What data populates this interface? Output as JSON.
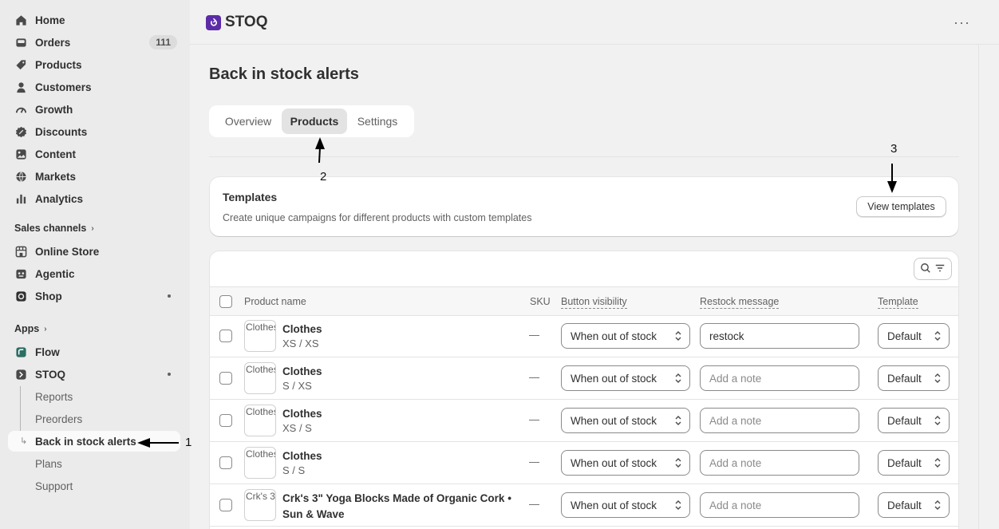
{
  "sidebar": {
    "items": [
      {
        "label": "Home",
        "icon": "home-icon"
      },
      {
        "label": "Orders",
        "icon": "inbox-icon",
        "badge": "111"
      },
      {
        "label": "Products",
        "icon": "tag-icon"
      },
      {
        "label": "Customers",
        "icon": "person-icon"
      },
      {
        "label": "Growth",
        "icon": "gauge-icon"
      },
      {
        "label": "Discounts",
        "icon": "discount-icon"
      },
      {
        "label": "Content",
        "icon": "content-icon"
      },
      {
        "label": "Markets",
        "icon": "globe-icon"
      },
      {
        "label": "Analytics",
        "icon": "bar-chart-icon"
      }
    ],
    "sales_channels_label": "Sales channels",
    "channels": [
      {
        "label": "Online Store",
        "icon": "store-icon"
      },
      {
        "label": "Agentic",
        "icon": "robot-icon"
      },
      {
        "label": "Shop",
        "icon": "shop-icon"
      }
    ],
    "apps_label": "Apps",
    "apps": [
      {
        "label": "Flow",
        "icon": "flow-icon"
      },
      {
        "label": "STOQ",
        "icon": "stoq-icon"
      }
    ],
    "stoq_sub": [
      {
        "label": "Reports"
      },
      {
        "label": "Preorders"
      },
      {
        "label": "Back in stock alerts"
      },
      {
        "label": "Plans"
      },
      {
        "label": "Support"
      }
    ]
  },
  "topbar": {
    "app_name": "STOQ",
    "more": "···"
  },
  "page": {
    "title": "Back in stock alerts",
    "tabs": [
      "Overview",
      "Products",
      "Settings"
    ],
    "active_tab": "Products"
  },
  "templates_card": {
    "title": "Templates",
    "description": "Create unique campaigns for different products with custom templates",
    "button": "View templates"
  },
  "table": {
    "headers": {
      "product": "Product name",
      "sku": "SKU",
      "visibility": "Button visibility",
      "message": "Restock message",
      "template": "Template"
    },
    "rows": [
      {
        "thumb_alt": "Clothes",
        "name": "Clothes",
        "variant": "XS / XS",
        "sku": "—",
        "visibility": "When out of stock",
        "message": "restock",
        "message_placeholder": "",
        "template": "Default"
      },
      {
        "thumb_alt": "Clothes",
        "name": "Clothes",
        "variant": "S / XS",
        "sku": "—",
        "visibility": "When out of stock",
        "message": "",
        "message_placeholder": "Add a note",
        "template": "Default"
      },
      {
        "thumb_alt": "Clothes",
        "name": "Clothes",
        "variant": "XS / S",
        "sku": "—",
        "visibility": "When out of stock",
        "message": "",
        "message_placeholder": "Add a note",
        "template": "Default"
      },
      {
        "thumb_alt": "Clothes",
        "name": "Clothes",
        "variant": "S / S",
        "sku": "—",
        "visibility": "When out of stock",
        "message": "",
        "message_placeholder": "Add a note",
        "template": "Default"
      },
      {
        "thumb_alt": "Crk's 3\" Yoga Blocks Made of Organic Cork",
        "name": "Crk's 3\" Yoga Blocks Made of Organic Cork • Sun & Wave",
        "variant": "",
        "sku": "—",
        "visibility": "When out of stock",
        "message": "",
        "message_placeholder": "Add a note",
        "template": "Default"
      }
    ]
  },
  "annotations": [
    "1",
    "2",
    "3"
  ],
  "colors": {
    "app_logo": "#5c2ca8",
    "sidebar_bg": "#ebebeb",
    "page_bg": "#f1f1f1"
  }
}
